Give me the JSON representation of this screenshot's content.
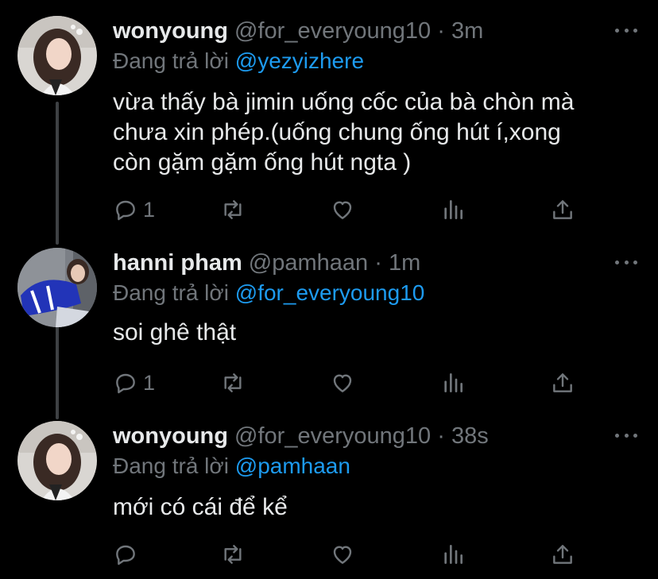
{
  "reply_prefix": "Đang trả lời",
  "colors": {
    "background": "#000000",
    "text": "#e7e9ea",
    "muted": "#71767b",
    "mention": "#1d9bf0",
    "thread_line": "#3e4144"
  },
  "tweets": [
    {
      "name": "wonyoung",
      "handle": "@for_everyoung10",
      "sep": "·",
      "time": "3m",
      "reply_to": "@yezyizhere",
      "text_lines": [
        "vừa thấy bà jimin uống cốc của bà chòn mà",
        "chưa xin phép.(uống chung ống hút í,xong",
        "còn gặm gặm ống hút ngta )"
      ],
      "reply_count": "1",
      "avatar_icon": "profile-photo"
    },
    {
      "name": "hanni pham",
      "handle": "@pamhaan",
      "sep": "·",
      "time": "1m",
      "reply_to": "@for_everyoung10",
      "text_lines": [
        "soi ghê thật"
      ],
      "reply_count": "1",
      "avatar_icon": "profile-photo"
    },
    {
      "name": "wonyoung",
      "handle": "@for_everyoung10",
      "sep": "·",
      "time": "38s",
      "reply_to": "@pamhaan",
      "text_lines": [
        "mới có cái để kể"
      ],
      "reply_count": "",
      "avatar_icon": "profile-photo"
    }
  ],
  "icons": [
    "reply-icon",
    "retweet-icon",
    "like-icon",
    "views-icon",
    "share-icon",
    "more-icon"
  ]
}
